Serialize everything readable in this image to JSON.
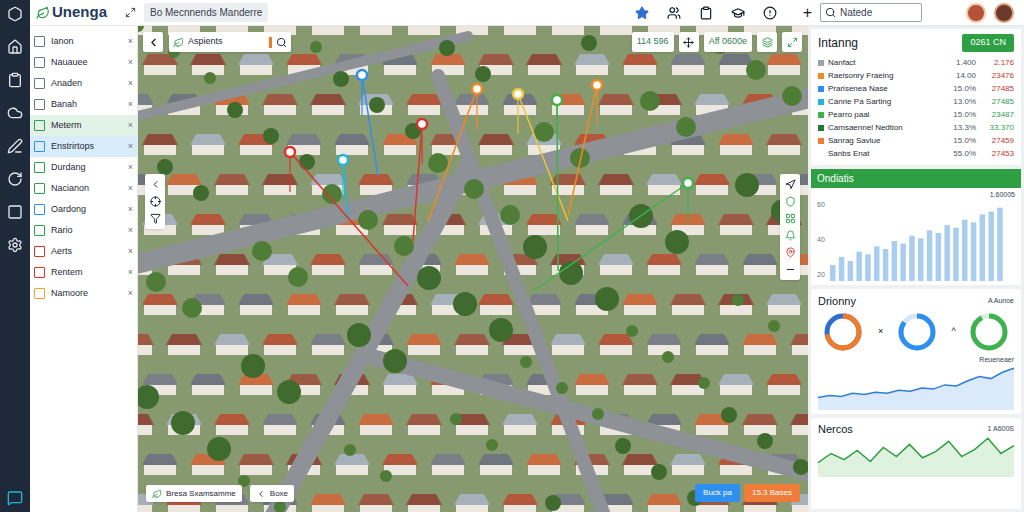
{
  "app": {
    "logo": "Unenga",
    "tab": "Bo Mecnnends Manderre",
    "add": "+",
    "search": {
      "placeholder": "Natede"
    }
  },
  "sidebar": {
    "close": "×",
    "items": [
      {
        "label": "Ianon",
        "selected": false,
        "color": "#6b7280"
      },
      {
        "label": "Nauauee",
        "selected": false,
        "color": "#6b7280"
      },
      {
        "label": "Anaden",
        "selected": false,
        "color": "#6b7280"
      },
      {
        "label": "Banah",
        "selected": false,
        "color": "#6b7280"
      },
      {
        "label": "Meterm",
        "selected": true,
        "color": "#2e9e4f"
      },
      {
        "label": "Enstrirtops",
        "selected": true,
        "color": "#2f8ff0"
      },
      {
        "label": "Durdang",
        "selected": false,
        "color": "#2e9e4f"
      },
      {
        "label": "Nacianon",
        "selected": false,
        "color": "#2e9e4f"
      },
      {
        "label": "Oardong",
        "selected": false,
        "color": "#2f8ff0"
      },
      {
        "label": "Rario",
        "selected": false,
        "color": "#2e9e4f"
      },
      {
        "label": "Aerts",
        "selected": false,
        "color": "#d9342b"
      },
      {
        "label": "Rentem",
        "selected": false,
        "color": "#d9342b"
      },
      {
        "label": "Namoore",
        "selected": false,
        "color": "#e8a33a"
      }
    ]
  },
  "map": {
    "search": {
      "value": "Aspients"
    },
    "stats": [
      "114 596",
      "Aff 0600e"
    ],
    "buttons": [
      "Bresa Sxamsamme",
      "Boxe"
    ],
    "badges": [
      {
        "label": "Buck pa",
        "color": "#2f8ff0"
      },
      {
        "label": "15.3 Bases",
        "color": "#f07c3a"
      }
    ],
    "pins": [
      {
        "color": "#d9342b"
      },
      {
        "color": "#22b5d6"
      },
      {
        "color": "#2f8ff0"
      },
      {
        "color": "#d9342b"
      },
      {
        "color": "#f08a24"
      },
      {
        "color": "#e8c53a"
      },
      {
        "color": "#3fb24f"
      },
      {
        "color": "#f08a24"
      },
      {
        "color": "#3fb24f"
      }
    ]
  },
  "panel": {
    "title": "Intanng",
    "button": "0261 CN",
    "rows": [
      {
        "name": "Nanfact",
        "value": "1.400",
        "change": "2.176",
        "color": "#9ca3af",
        "change_color": "#c0392b"
      },
      {
        "name": "Raeisonry Fraeing",
        "value": "14.00",
        "change": "23476",
        "color": "#f08a24",
        "change_color": "#c0392b"
      },
      {
        "name": "Prarisenea Nase",
        "value": "15.0%",
        "change": "27485",
        "color": "#2f8ff0",
        "change_color": "#c0392b"
      },
      {
        "name": "Canrie Pa Sarting",
        "value": "13.0%",
        "change": "27485",
        "color": "#22b5d6",
        "change_color": "#2e9e4f"
      },
      {
        "name": "Pearro paal",
        "value": "15.0%",
        "change": "23487",
        "color": "#3fb24f",
        "change_color": "#2e9e4f"
      },
      {
        "name": "Camsaennel Nedtion",
        "value": "13.3%",
        "change": "33.370",
        "color": "#1f7a3a",
        "change_color": "#2e9e4f"
      },
      {
        "name": "Sanrag Saviue",
        "value": "15.0%",
        "change": "27459",
        "color": "#f07c3a",
        "change_color": "#c0392b"
      },
      {
        "name": "Sanbs Enat",
        "value": "55.0%",
        "change": "27453",
        "color": "#ffffff",
        "change_color": "#c0392b"
      }
    ]
  },
  "bars": {
    "title": "Ondiatis",
    "caption": "1.60005",
    "ticks": [
      "60",
      "40",
      "20"
    ],
    "values": [
      12,
      18,
      15,
      22,
      20,
      26,
      24,
      30,
      28,
      34,
      32,
      38,
      36,
      42,
      40,
      46,
      44,
      50,
      52,
      55
    ]
  },
  "donut_card": {
    "title": "Drionny",
    "caption": "A Aunoe",
    "donuts": [
      {
        "level": 0.72,
        "color": "#f07c2a",
        "track": "#2f6fd0"
      },
      {
        "level": 0.85,
        "color": "#2f8ff0",
        "track": "#d6e6f7"
      },
      {
        "level": 0.92,
        "color": "#3fb24f",
        "track": "#dcefdc"
      }
    ],
    "separators": [
      "×",
      "^"
    ],
    "line_caption": "Reueneaer",
    "values": [
      10,
      12,
      11,
      14,
      13,
      15,
      14,
      17,
      16,
      19,
      18,
      22,
      21,
      26,
      30,
      28,
      34,
      38
    ]
  },
  "trend_card": {
    "title": "Nercos",
    "caption": "1 A600S",
    "values": [
      20,
      35,
      25,
      40,
      22,
      45,
      30,
      50,
      28,
      38,
      55,
      30,
      42,
      60,
      35,
      48
    ]
  }
}
